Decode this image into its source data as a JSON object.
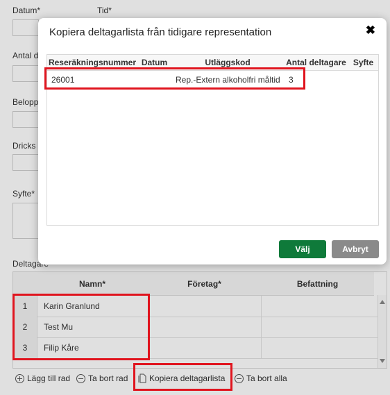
{
  "form": {
    "datum_label": "Datum*",
    "tid_label": "Tid*",
    "antal_label": "Antal d",
    "belopp_label": "Belopp",
    "dricks_label": "Dricks",
    "syfte_label": "Syfte*",
    "deltagare_label": "Deltagare"
  },
  "grid": {
    "headers": [
      "",
      "Namn*",
      "Företag*",
      "Befattning"
    ],
    "rows": [
      {
        "num": "1",
        "name": "Karin Granlund"
      },
      {
        "num": "2",
        "name": "Test Mu"
      },
      {
        "num": "3",
        "name": "Filip Kåre"
      }
    ]
  },
  "toolbar": {
    "add_row": "Lägg till rad",
    "remove_row": "Ta bort rad",
    "copy_list": "Kopiera deltagarlista",
    "remove_all": "Ta bort alla"
  },
  "modal": {
    "title": "Kopiera deltagarlista från tidigare representation",
    "close": "✖",
    "headers": [
      "Reseräkningsnummer",
      "Datum",
      "Utläggskod",
      "Antal deltagare",
      "Syfte"
    ],
    "rows": [
      {
        "nummer": "26001",
        "datum": "",
        "kod": "Rep.-Extern alkoholfri måltid",
        "antal": "3",
        "syfte": ""
      }
    ],
    "btn_select": "Välj",
    "btn_cancel": "Avbryt"
  },
  "colors": {
    "highlight": "#e0141e",
    "primary": "#0f7a3a",
    "secondary": "#8a8a8a"
  }
}
